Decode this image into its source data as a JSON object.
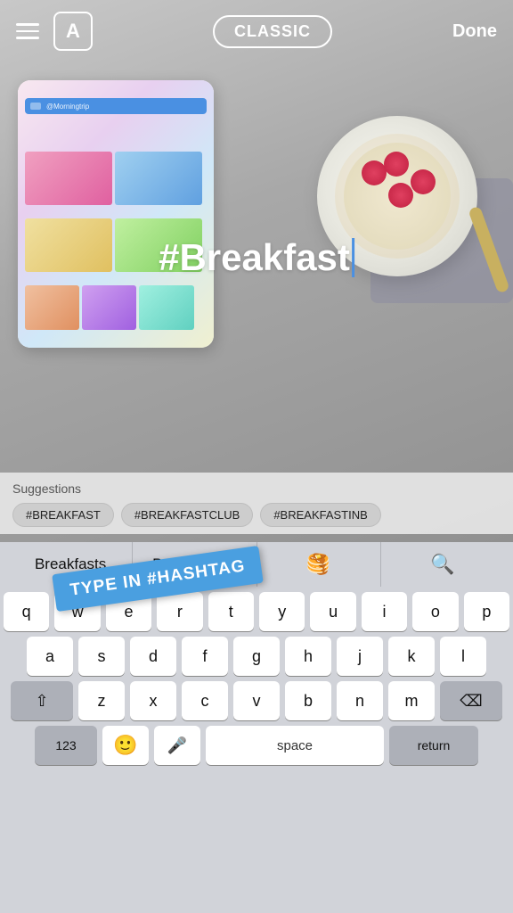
{
  "toolbar": {
    "font_button_label": "A",
    "classic_button_label": "CLASSIC",
    "done_button_label": "Done"
  },
  "canvas": {
    "hashtag_text": "#Breakfast"
  },
  "suggestions": {
    "label": "Suggestions",
    "chips": [
      "#BREAKFAST",
      "#BREAKFASTCLUB",
      "#BREAKFASTINB"
    ]
  },
  "autocomplete": {
    "items": [
      "Breakfasts",
      "Breakfasting",
      "🥞",
      "🔍"
    ]
  },
  "sticker": {
    "text": "TYPE IN #HASHTAG"
  },
  "keyboard": {
    "row1": [
      "q",
      "w",
      "e",
      "r",
      "t",
      "y",
      "u",
      "i",
      "o",
      "p"
    ],
    "row2": [
      "a",
      "s",
      "d",
      "f",
      "g",
      "h",
      "j",
      "k",
      "l"
    ],
    "row3": [
      "z",
      "x",
      "c",
      "v",
      "b",
      "n",
      "m"
    ],
    "space_label": "space",
    "return_label": "return",
    "numbers_label": "123"
  }
}
